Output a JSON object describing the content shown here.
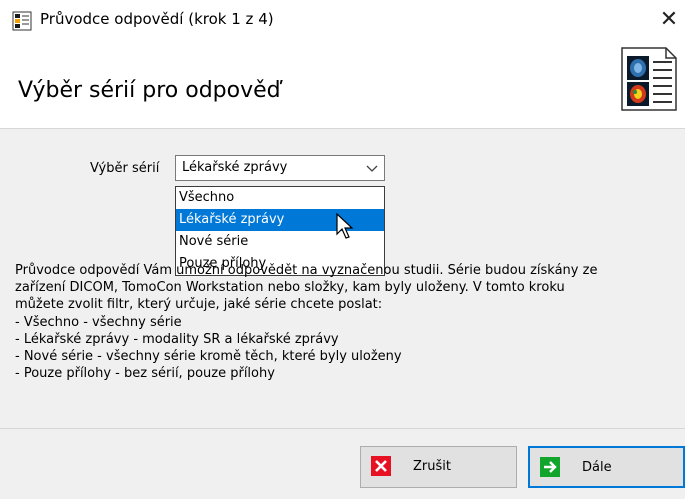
{
  "window": {
    "title": "Průvodce odpovědí (krok 1 z 4)",
    "close_symbol": "✕"
  },
  "header": {
    "title": "Výběr sérií pro odpověď",
    "image": "medical-report-icon"
  },
  "form": {
    "series_label": "Výběr sérií",
    "selected_value": "Lékařské zprávy",
    "options": [
      "Všechno",
      "Lékařské zprávy",
      "Nové série",
      "Pouze přílohy"
    ],
    "highlighted_index": 1
  },
  "description": {
    "lines": [
      "Průvodce odpovědí Vám umožní odpovědět na vyznačenou studii. Série budou získány ze",
      "zařízení DICOM, TomoCon Workstation nebo složky, kam byly uloženy. V tomto kroku",
      "můžete zvolit filtr, který určuje, jaké série chcete poslat:",
      "- Všechno - všechny série",
      "- Lékařské zprávy - modality SR a lékařské zprávy",
      "- Nové série - všechny série kromě těch, které byly uloženy",
      "- Pouze přílohy - bez sérií, pouze přílohy"
    ]
  },
  "buttons": {
    "cancel": {
      "label": "Zrušit",
      "icon": "red-x-icon"
    },
    "next": {
      "label": "Dále",
      "icon": "green-arrow-icon"
    }
  },
  "colors": {
    "selection": "#0078d7",
    "cancel_icon": "#e81123",
    "next_icon": "#12a52b"
  }
}
